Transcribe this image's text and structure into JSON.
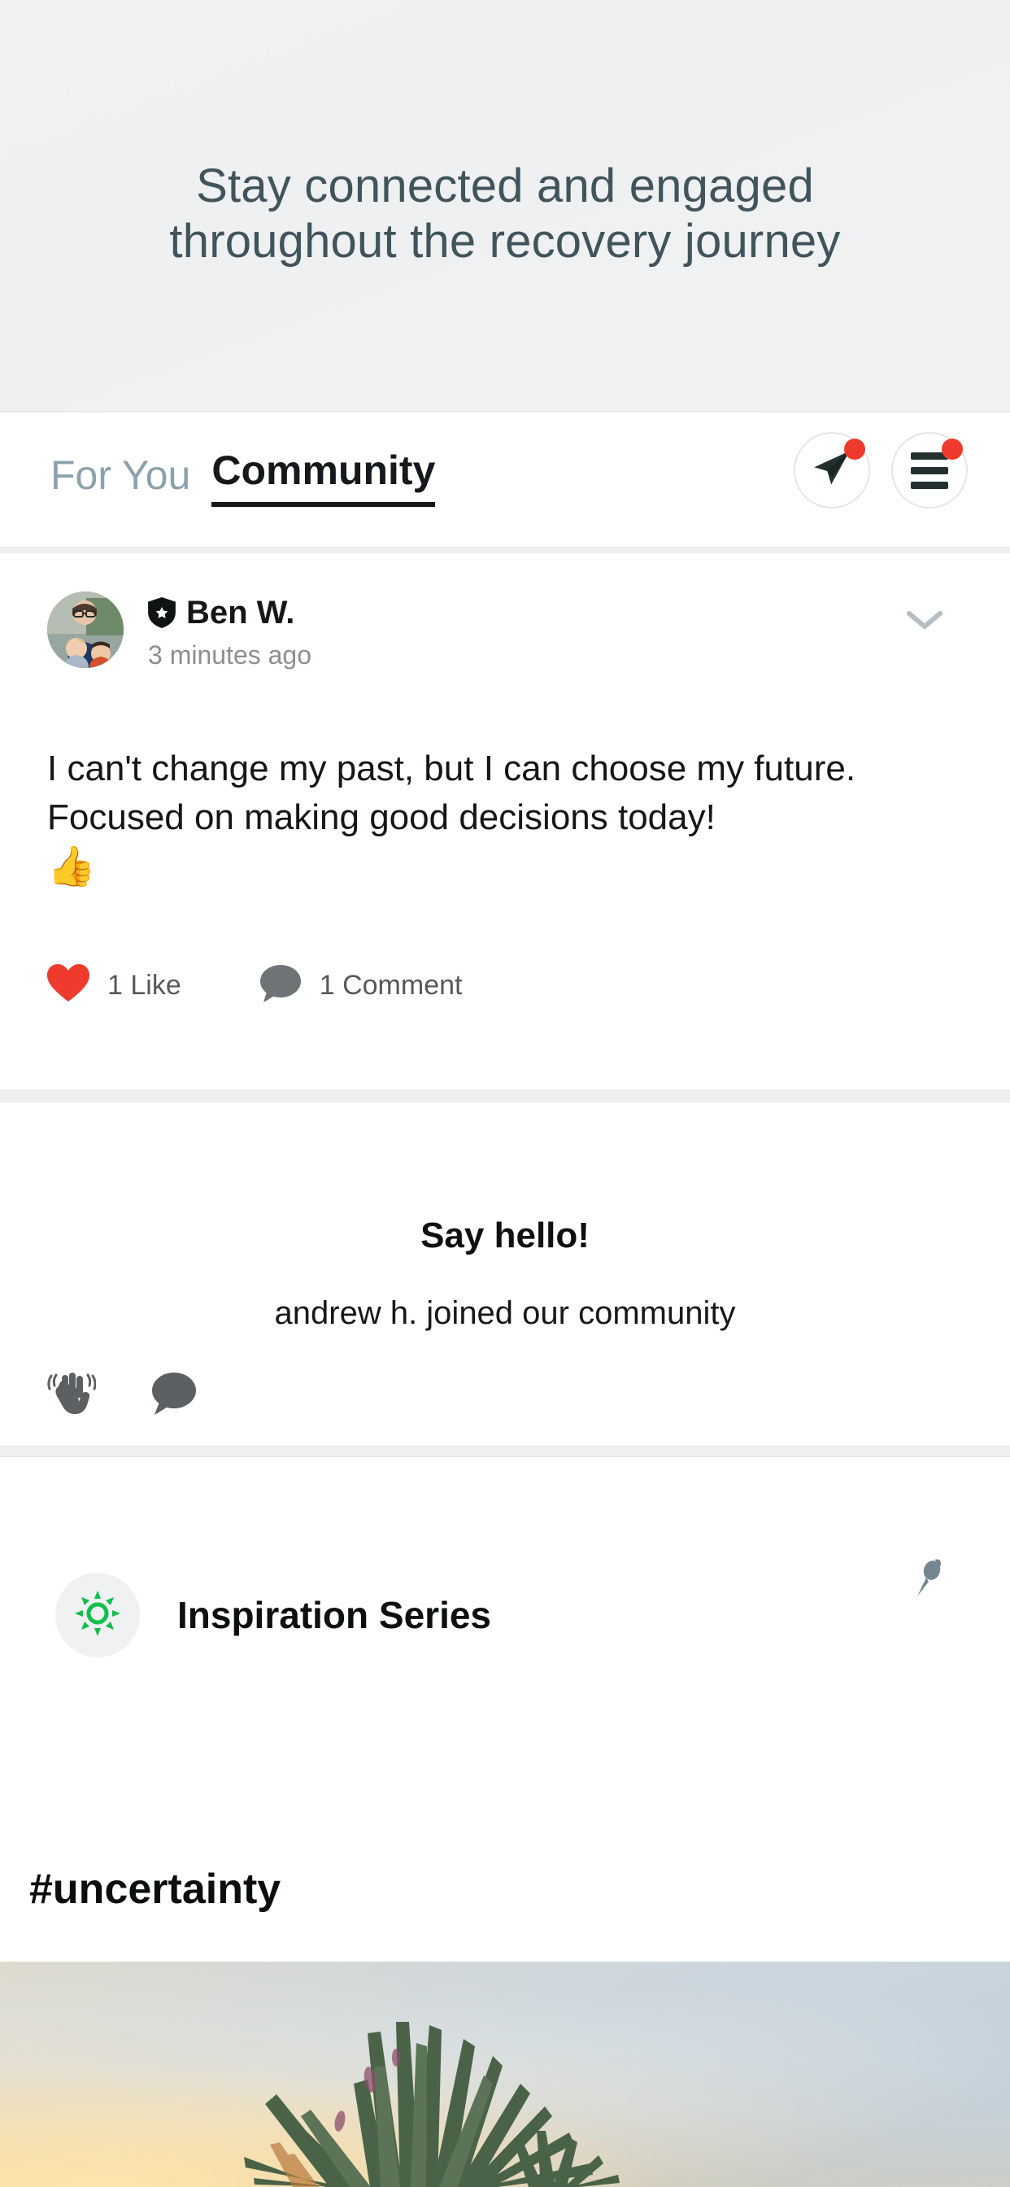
{
  "hero": {
    "line1": "Stay connected and engaged",
    "line2": "throughout the recovery journey",
    "background_color": "#eff1f2",
    "text_color": "#41545c"
  },
  "tabbar": {
    "tabs": [
      {
        "label": "For You",
        "active": false
      },
      {
        "label": "Community",
        "active": true
      }
    ],
    "active_color": "#15191b",
    "inactive_color": "#8ba2ad",
    "actions": [
      {
        "name": "send-message-button",
        "icon": "send-icon",
        "has_notification": true
      },
      {
        "name": "menu-button",
        "icon": "hamburger-icon",
        "has_notification": true
      }
    ],
    "notification_color": "#ef3b2d"
  },
  "post": {
    "author": "Ben W.",
    "author_badge": "shield-star-icon",
    "timestamp": "3 minutes ago",
    "body": "I can't change my past, but I can choose my future. Focused on making good decisions today!",
    "body_emoji": "👍",
    "like_count_label": "1 Like",
    "comment_count_label": "1 Comment",
    "like_icon_color": "#ef3b2d",
    "comment_icon_color": "#6e7376",
    "more_icon": "chevron-down-icon"
  },
  "hello": {
    "title": "Say hello!",
    "subtitle": "andrew h. joined our community",
    "actions": [
      {
        "name": "wave-reaction-button",
        "icon": "waving-hand-icon"
      },
      {
        "name": "comment-button",
        "icon": "speech-bubble-icon"
      }
    ],
    "icon_color": "#5c6063"
  },
  "series": {
    "title": "Inspiration Series",
    "avatar_icon": "sun-icon",
    "avatar_icon_color": "#0fc04a",
    "avatar_background": "#f0f1f2",
    "pin_icon": "pushpin-icon",
    "pin_icon_color": "#74868f",
    "hashtag": "#uncertainty",
    "photo_alt": "agave-plant-sunset-photo"
  }
}
